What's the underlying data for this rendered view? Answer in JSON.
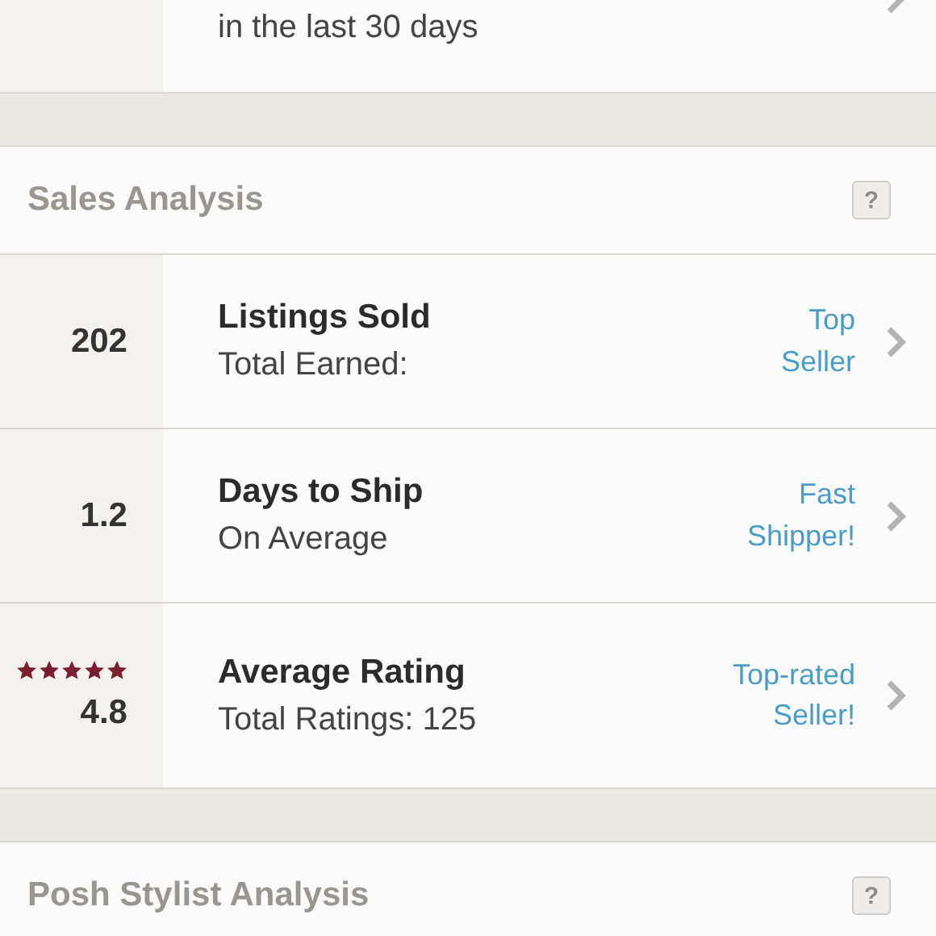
{
  "top_row": {
    "subtitle": "in the last 30 days"
  },
  "sections": [
    {
      "title": "Sales Analysis",
      "help": "?",
      "rows": [
        {
          "kind": "count",
          "value": "202",
          "title": "Listings Sold",
          "subtitle": "Total Earned:",
          "badge": "Top\nSeller"
        },
        {
          "kind": "count",
          "value": "1.2",
          "title": "Days to Ship",
          "subtitle": "On Average",
          "badge": "Fast\nShipper!"
        },
        {
          "kind": "rating",
          "stars": 5,
          "value": "4.8",
          "title": "Average Rating",
          "subtitle": "Total Ratings: 125",
          "badge": "Top-rated\nSeller!"
        }
      ]
    },
    {
      "title": "Posh Stylist Analysis",
      "help": "?"
    }
  ]
}
